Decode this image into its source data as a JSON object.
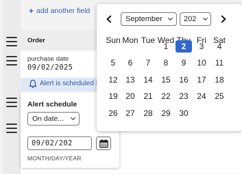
{
  "add_field": {
    "icon": "plus-icon",
    "label": "add another field"
  },
  "order": {
    "title": "Order"
  },
  "purchase_date": {
    "label": "purchase date",
    "value": "09/02/2025"
  },
  "alert": {
    "icon": "bell-icon",
    "text": "Alert is scheduled fo"
  },
  "schedule": {
    "title": "Alert schedule",
    "mode": "On date...",
    "date_value": "09/02/202",
    "format_hint": "MONTH/DAY/YEAR"
  },
  "datepicker": {
    "month": "September",
    "year": "202",
    "weekdays": [
      "Sun",
      "Mon",
      "Tue",
      "Wed",
      "Thu",
      "Fri",
      "Sat"
    ],
    "weeks": [
      [
        "",
        "1",
        "2",
        "3",
        "4"
      ],
      [
        "5",
        "6",
        "7",
        "8",
        "9",
        "10",
        "11"
      ],
      [
        "12",
        "13",
        "14",
        "15",
        "16",
        "17",
        "18"
      ],
      [
        "19",
        "20",
        "21",
        "22",
        "23",
        "24",
        "25"
      ],
      [
        "26",
        "27",
        "28",
        "29",
        "30"
      ]
    ],
    "selected_day": "2"
  },
  "colors": {
    "accent": "#2f67d0",
    "link": "#2f5fb3",
    "alert_bg": "#dfe8f6"
  }
}
